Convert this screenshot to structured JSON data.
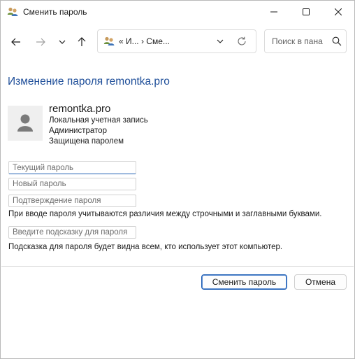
{
  "window": {
    "title": "Сменить пароль",
    "icon": "users-icon"
  },
  "nav": {
    "address_path": "«  И...  ›  Сме...",
    "address_icon": "users-icon",
    "search_placeholder": "Поиск в пана"
  },
  "page": {
    "title": "Изменение пароля remontka.pro"
  },
  "user": {
    "name": "remontka.pro",
    "account_type": "Локальная учетная запись",
    "role": "Администратор",
    "protection": "Защищена паролем",
    "avatar_icon": "person-icon"
  },
  "form": {
    "current_password_placeholder": "Текущий пароль",
    "new_password_placeholder": "Новый пароль",
    "confirm_password_placeholder": "Подтверждение пароля",
    "case_note": "При вводе пароля учитываются различия между строчными и заглавными буквами.",
    "hint_placeholder": "Введите подсказку для пароля",
    "hint_note": "Подсказка для пароля будет видна всем, кто использует этот компьютер."
  },
  "buttons": {
    "change_label": "Сменить пароль",
    "cancel_label": "Отмена"
  },
  "colors": {
    "accent": "#1f5fb5",
    "title_blue": "#1e4e99"
  }
}
